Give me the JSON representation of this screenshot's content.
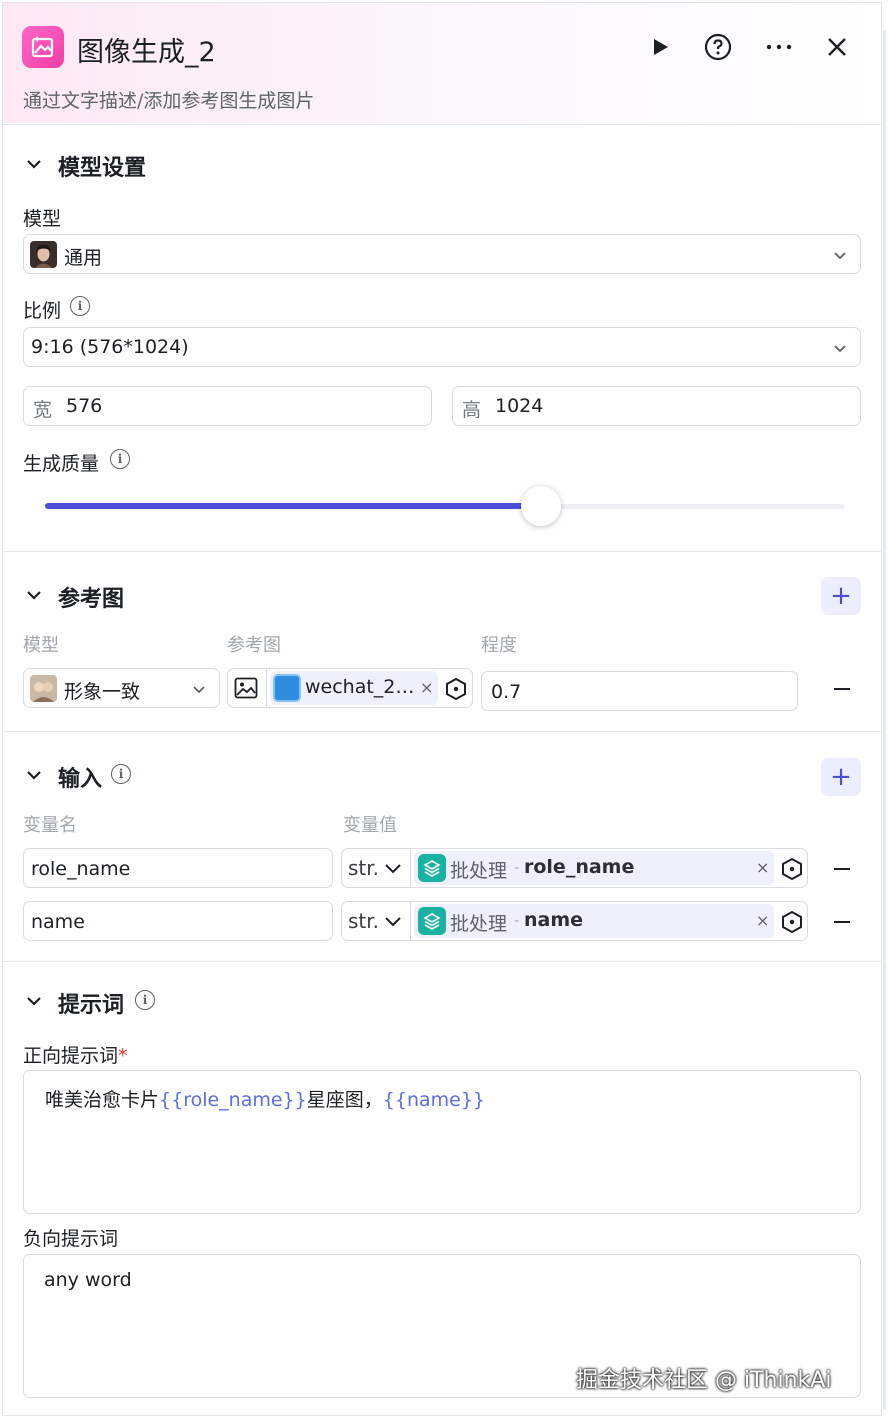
{
  "header": {
    "title": "图像生成_2",
    "description": "通过文字描述/添加参考图生成图片"
  },
  "model_section": {
    "title": "模型设置",
    "model_label": "模型",
    "model_value": "通用",
    "ratio_label": "比例",
    "ratio_value": "9:16 (576*1024)",
    "width_label": "宽",
    "width_value": "576",
    "height_label": "高",
    "height_value": "1024",
    "quality_label": "生成质量",
    "quality_level": 0.62
  },
  "reference_section": {
    "title": "参考图",
    "col_model": "模型",
    "col_image": "参考图",
    "col_degree": "程度",
    "model_value": "形象一致",
    "image_name": "wechat_2…",
    "degree_value": "0.7"
  },
  "input_section": {
    "title": "输入",
    "col_name": "变量名",
    "col_value": "变量值",
    "rows": [
      {
        "name": "role_name",
        "type": "str.",
        "source": "批处理",
        "sep": "-",
        "field": "role_name"
      },
      {
        "name": "name",
        "type": "str.",
        "source": "批处理",
        "sep": "-",
        "field": "name"
      }
    ]
  },
  "prompt_section": {
    "title": "提示词",
    "positive_label": "正向提示词",
    "required_mark": "*",
    "positive_parts": [
      "唯美治愈卡片",
      "{{role_name}}",
      "星座图，",
      "{{name}}"
    ],
    "negative_label": "负向提示词",
    "negative_value": "any word"
  },
  "watermark": "掘金技术社区 @ iThinkAi",
  "colors": {
    "accent": "#4b4fd8",
    "header_icon": "#f03ea7",
    "variable": "#5b6de8",
    "tag_icon": "#18b2a2"
  }
}
